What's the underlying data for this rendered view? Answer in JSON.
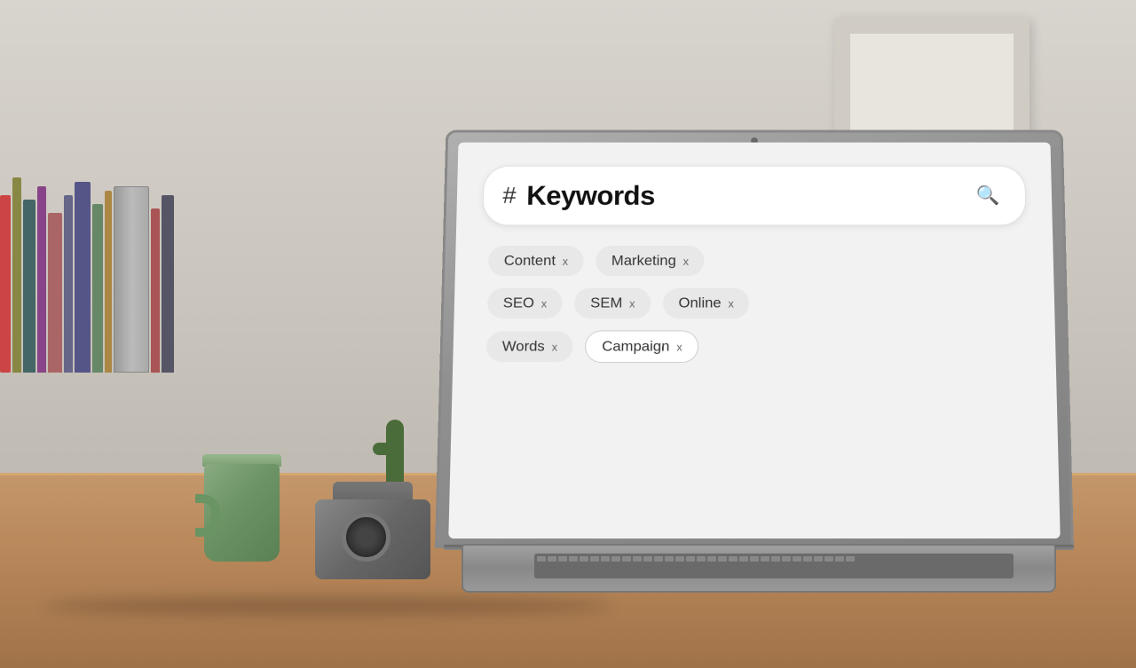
{
  "scene": {
    "background": "office desk with laptop"
  },
  "laptop": {
    "screen": {
      "search_bar": {
        "hash_symbol": "#",
        "placeholder": "Keywords",
        "search_icon": "🔍"
      },
      "tags": [
        {
          "id": "content",
          "label": "Content",
          "row": 1
        },
        {
          "id": "marketing",
          "label": "Marketing",
          "row": 1
        },
        {
          "id": "seo",
          "label": "SEO",
          "row": 2
        },
        {
          "id": "sem",
          "label": "SEM",
          "row": 2
        },
        {
          "id": "online",
          "label": "Online",
          "row": 2
        },
        {
          "id": "words",
          "label": "Words",
          "row": 3
        },
        {
          "id": "campaign",
          "label": "Campaign",
          "row": 3
        }
      ]
    }
  },
  "close_symbol": "x"
}
